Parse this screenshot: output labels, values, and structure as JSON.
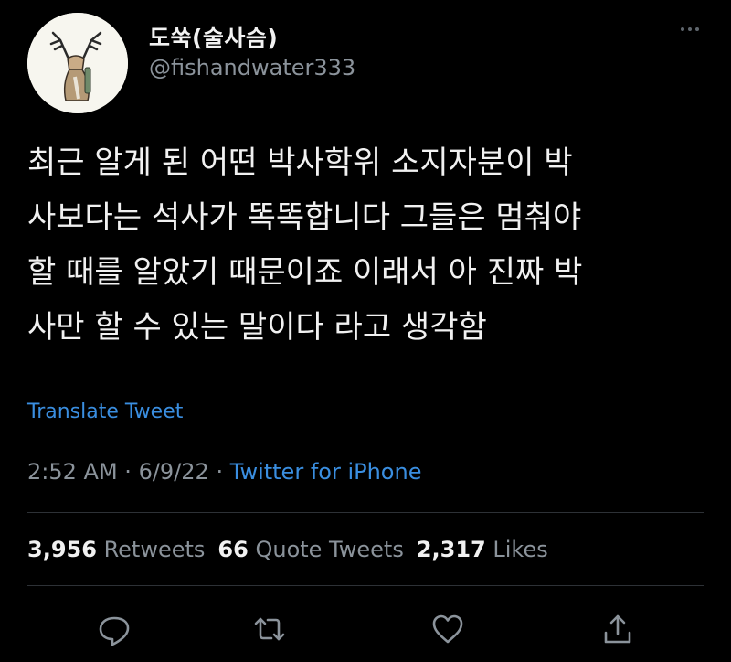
{
  "user": {
    "display_name": "도쑥(술사슴)",
    "handle": "@fishandwater333"
  },
  "tweet": {
    "lines": [
      "최근 알게 된 어떤 박사학위 소지자분이 박",
      "사보다는 석사가 똑똑합니다 그들은 멈춰야",
      "할 때를 알았기 때문이죠 이래서 아 진짜 박",
      "사만 할 수 있는 말이다 라고 생각함"
    ],
    "translate_label": "Translate Tweet"
  },
  "meta": {
    "time": "2:52 AM",
    "separator": "·",
    "date": "6/9/22",
    "source": "Twitter for iPhone"
  },
  "stats": {
    "retweets_count": "3,956",
    "retweets_label": "Retweets",
    "quotes_count": "66",
    "quotes_label": "Quote Tweets",
    "likes_count": "2,317",
    "likes_label": "Likes"
  },
  "actions": [
    "reply-icon",
    "retweet-icon",
    "like-icon",
    "share-icon"
  ],
  "colors": {
    "background": "#000000",
    "link": "#3a8ee0",
    "muted": "#8b939b",
    "text": "#f1f1f1"
  }
}
